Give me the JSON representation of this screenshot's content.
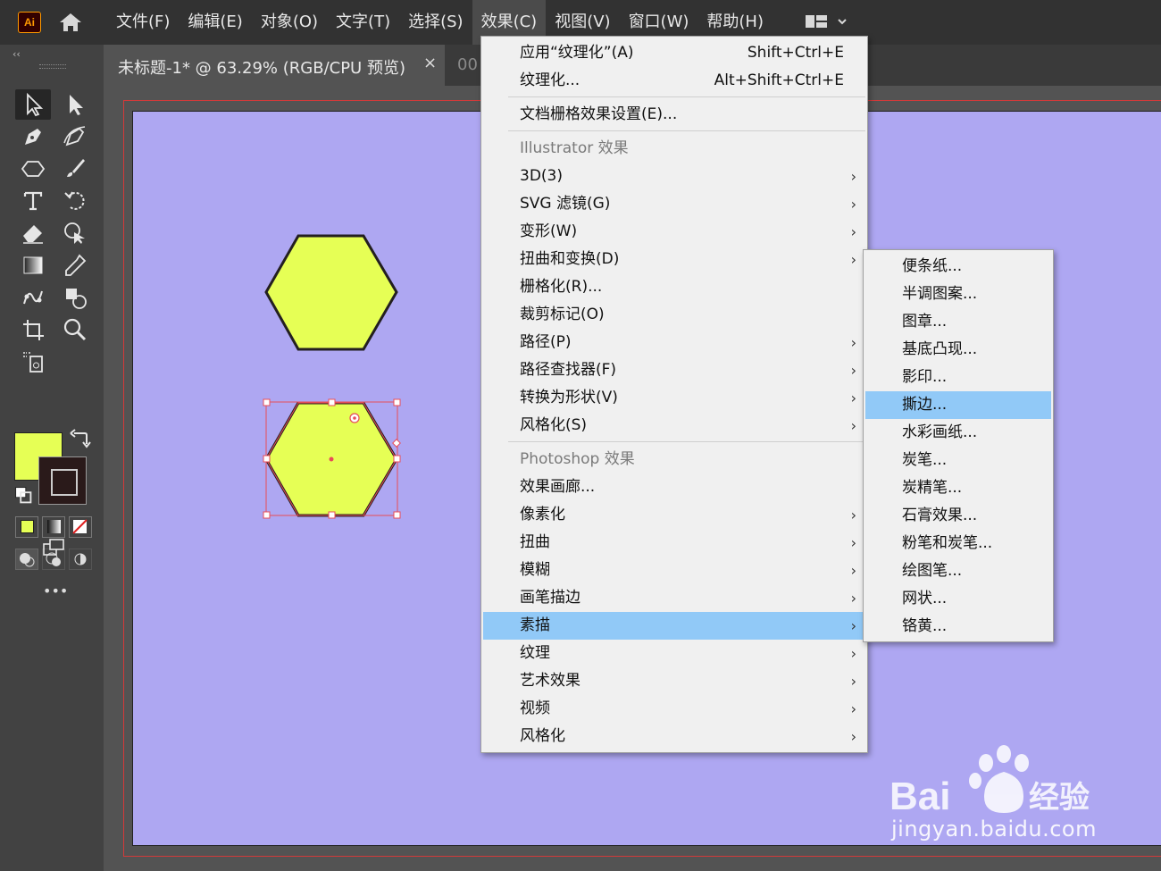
{
  "app": {
    "logo": "Ai",
    "home_icon": "home-icon",
    "workspace_icon": "workspace-switcher-icon"
  },
  "menubar": {
    "items": [
      "文件(F)",
      "编辑(E)",
      "对象(O)",
      "文字(T)",
      "选择(S)",
      "效果(C)",
      "视图(V)",
      "窗口(W)",
      "帮助(H)"
    ],
    "active": "效果(C)"
  },
  "document": {
    "tab_title": "未标题-1* @ 63.29% (RGB/CPU 预览)",
    "close_symbol": "×",
    "second_tab": "00"
  },
  "toolbar": {
    "collapse": "‹‹",
    "more": "•••"
  },
  "colors": {
    "fill": "#e6ff55",
    "artboard": "#aea7f2",
    "highlight": "#91c9f7",
    "selection": "#e84c57"
  },
  "effect_menu": {
    "items": [
      {
        "label": "应用“纹理化”(A)",
        "shortcut": "Shift+Ctrl+E",
        "type": "item"
      },
      {
        "label": "纹理化...",
        "shortcut": "Alt+Shift+Ctrl+E",
        "type": "item"
      },
      {
        "label": "文档栅格效果设置(E)...",
        "type": "item"
      },
      {
        "label": "Illustrator 效果",
        "type": "header"
      },
      {
        "label": "3D(3)",
        "submenu": true
      },
      {
        "label": "SVG 滤镜(G)",
        "submenu": true
      },
      {
        "label": "变形(W)",
        "submenu": true
      },
      {
        "label": "扭曲和变换(D)",
        "submenu": true
      },
      {
        "label": "栅格化(R)...",
        "submenu": false
      },
      {
        "label": "裁剪标记(O)",
        "submenu": false
      },
      {
        "label": "路径(P)",
        "submenu": true
      },
      {
        "label": "路径查找器(F)",
        "submenu": true
      },
      {
        "label": "转换为形状(V)",
        "submenu": true
      },
      {
        "label": "风格化(S)",
        "submenu": true
      },
      {
        "label": "Photoshop 效果",
        "type": "header"
      },
      {
        "label": "效果画廊...",
        "submenu": false
      },
      {
        "label": "像素化",
        "submenu": true
      },
      {
        "label": "扭曲",
        "submenu": true
      },
      {
        "label": "模糊",
        "submenu": true
      },
      {
        "label": "画笔描边",
        "submenu": true
      },
      {
        "label": "素描",
        "submenu": true,
        "highlighted": true
      },
      {
        "label": "纹理",
        "submenu": true
      },
      {
        "label": "艺术效果",
        "submenu": true
      },
      {
        "label": "视频",
        "submenu": true
      },
      {
        "label": "风格化",
        "submenu": true
      }
    ]
  },
  "sketch_submenu": {
    "items": [
      "便条纸...",
      "半调图案...",
      "图章...",
      "基底凸现...",
      "影印...",
      "撕边...",
      "水彩画纸...",
      "炭笔...",
      "炭精笔...",
      "石膏效果...",
      "粉笔和炭笔...",
      "绘图笔...",
      "网状...",
      "铬黄..."
    ],
    "highlighted_index": 5
  },
  "watermark": {
    "brand": "Bai经验",
    "url": "jingyan.baidu.com"
  }
}
